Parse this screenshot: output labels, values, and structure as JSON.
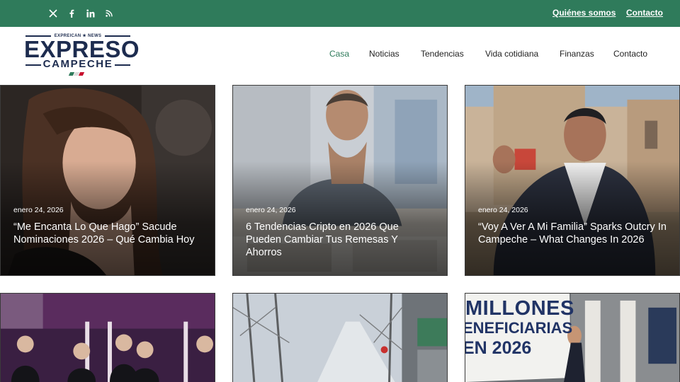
{
  "topbar": {
    "social_icons": [
      "x-icon",
      "facebook-icon",
      "linkedin-icon",
      "rss-icon"
    ],
    "links": [
      {
        "label": "Quiénes somos"
      },
      {
        "label": "Contacto"
      }
    ],
    "color": "#2f7b5b"
  },
  "logo": {
    "small_text": "EXPREICAN ★ NEWS",
    "main": "EXPRESO",
    "sub": "CAMPECHE",
    "flag_colors": [
      "#2f7b5b",
      "#ffffff",
      "#c8102e"
    ]
  },
  "nav": {
    "items": [
      {
        "label": "Casa",
        "active": true
      },
      {
        "label": "Noticias"
      },
      {
        "label": "Tendencias"
      },
      {
        "label": "Vida cotidiana"
      },
      {
        "label": "Finanzas"
      },
      {
        "label": "Contacto"
      }
    ]
  },
  "articles": [
    {
      "date": "enero 24, 2026",
      "title": "“Me Encanta Lo Que Hago” Sacude Nominaciones 2026 – Qué Cambia Hoy",
      "image": "woman-red-carpet-photo"
    },
    {
      "date": "enero 24, 2026",
      "title": "6 Tendencias Cripto en 2026 Que Pueden Cambiar Tus Remesas Y Ahorros",
      "image": "worried-man-at-desk-photo"
    },
    {
      "date": "enero 24, 2026",
      "title": "“Voy A Ver A Mi Familia” Sparks Outcry In Campeche – What Changes In 2026",
      "image": "man-shouting-plaza-photo"
    },
    {
      "date": "",
      "title": "",
      "image": "kpop-group-stage-photo"
    },
    {
      "date": "",
      "title": "",
      "image": "snowy-street-photo"
    },
    {
      "date": "",
      "title": "",
      "image": "protest-sign-photo",
      "sign_text": [
        "MILLONES",
        "ENEFICIARIAS",
        "EN 2026"
      ]
    }
  ]
}
